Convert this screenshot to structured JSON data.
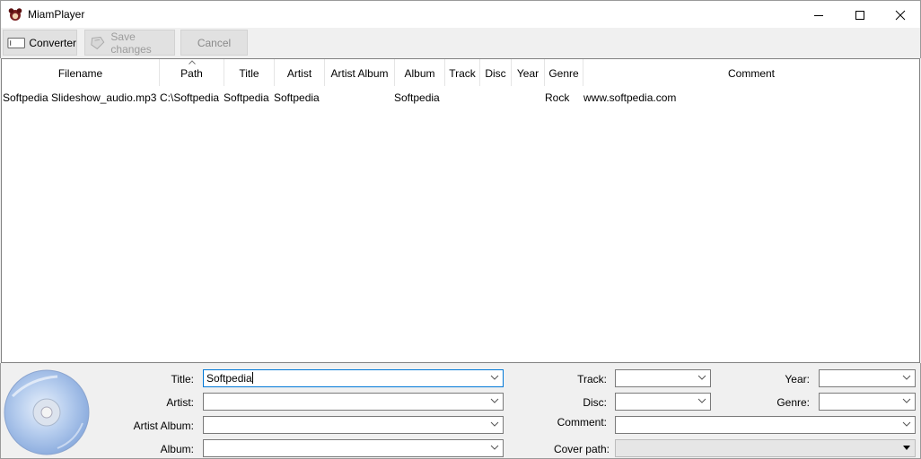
{
  "window": {
    "title": "MiamPlayer",
    "minimize_icon": "minimize-icon",
    "maximize_icon": "maximize-icon",
    "close_icon": "close-icon"
  },
  "toolbar": {
    "converter_label": "Converter",
    "save_label": "Save changes",
    "cancel_label": "Cancel"
  },
  "table": {
    "columns": [
      "Filename",
      "Path",
      "Title",
      "Artist",
      "Artist Album",
      "Album",
      "Track",
      "Disc",
      "Year",
      "Genre",
      "Comment"
    ],
    "rows": [
      {
        "filename": "Softpedia Slideshow_audio.mp3",
        "path": "C:\\Softpedia",
        "title": "Softpedia",
        "artist": "Softpedia",
        "artist_album": "",
        "album": "Softpedia",
        "track": "",
        "disc": "",
        "year": "",
        "genre": "Rock",
        "comment": "www.softpedia.com"
      }
    ]
  },
  "editor": {
    "labels": {
      "title": "Title:",
      "artist": "Artist:",
      "artist_album": "Artist Album:",
      "album": "Album:",
      "track": "Track:",
      "disc": "Disc:",
      "comment": "Comment:",
      "cover_path": "Cover path:",
      "year": "Year:",
      "genre": "Genre:"
    },
    "values": {
      "title": "Softpedia",
      "artist": "",
      "artist_album": "",
      "album": "",
      "track": "",
      "disc": "",
      "comment": "",
      "cover_path": "",
      "year": "",
      "genre": ""
    }
  },
  "colors": {
    "focus_border": "#0078d7",
    "disc_blue": "#a9c6ec"
  }
}
